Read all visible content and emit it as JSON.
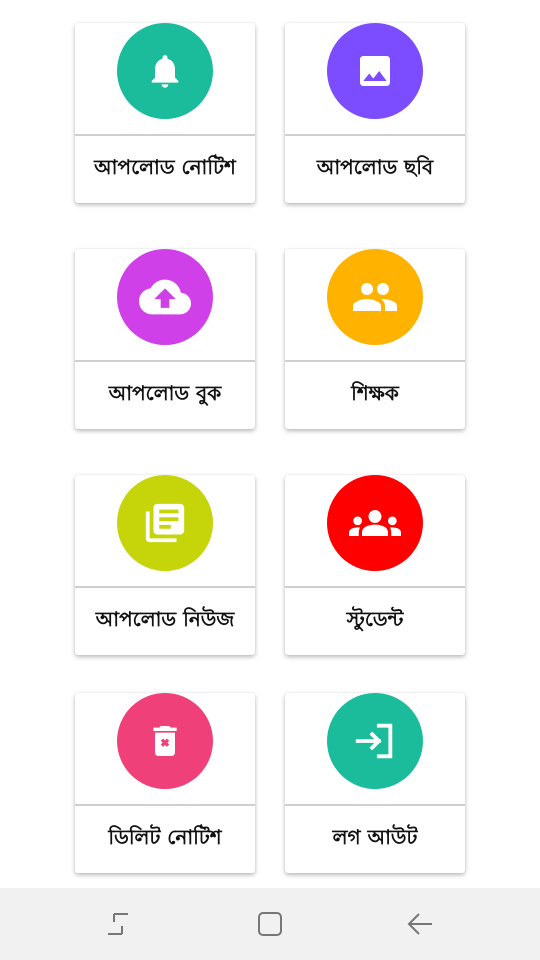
{
  "cards": [
    {
      "label": "আপলোড নোটিশ",
      "icon": "bell-icon",
      "color": "#1ABC9C"
    },
    {
      "label": "আপলোড ছবি",
      "icon": "image-icon",
      "color": "#7C4DFF"
    },
    {
      "label": "আপলোড বুক",
      "icon": "cloud-upload-icon",
      "color": "#D040E8"
    },
    {
      "label": "শিক্ষক",
      "icon": "people-icon",
      "color": "#FFB300"
    },
    {
      "label": "আপলোড নিউজ",
      "icon": "news-icon",
      "color": "#C6D40A"
    },
    {
      "label": "স্টুডেন্ট",
      "icon": "group-icon",
      "color": "#FF0000"
    },
    {
      "label": "ডিলিট নোটিশ",
      "icon": "trash-icon",
      "color": "#F0407A"
    },
    {
      "label": "লগ আউট",
      "icon": "login-icon",
      "color": "#1ABC9C"
    }
  ],
  "navbar": {
    "buttons": [
      "recent-apps-icon",
      "home-icon",
      "back-icon"
    ]
  }
}
